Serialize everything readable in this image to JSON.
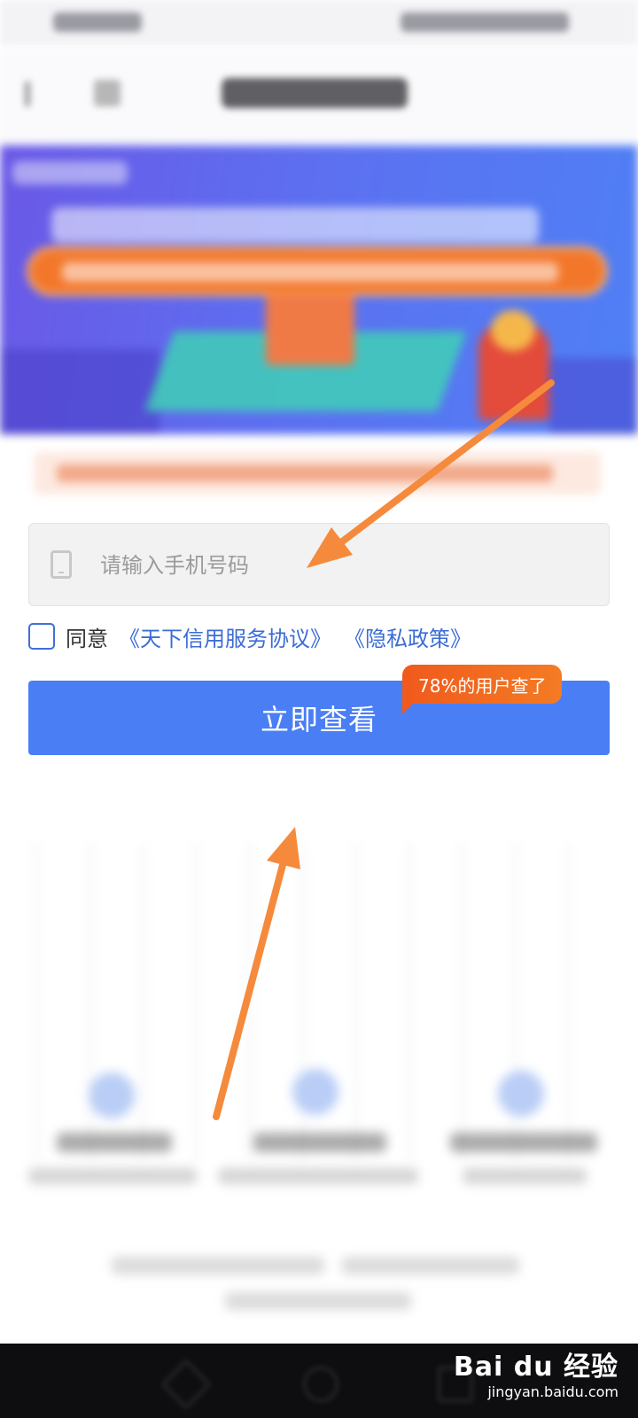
{
  "form": {
    "phone_placeholder": "请输入手机号码",
    "agree_label": "同意",
    "link_agreement": "《天下信用服务协议》",
    "link_privacy": "《隐私政策》",
    "submit_label": "立即查看",
    "badge_text": "78%的用户查了"
  },
  "watermark": {
    "brand": "Bai du 经验",
    "site": "jingyan.baidu.com"
  },
  "colors": {
    "primary": "#4a7ef5",
    "badge": "#f05a1c",
    "arrow": "#f58a3c",
    "link": "#3b6cd6"
  },
  "icons": [
    "phone-icon",
    "checkbox-icon",
    "back-icon",
    "close-icon",
    "arrow-annotation"
  ]
}
